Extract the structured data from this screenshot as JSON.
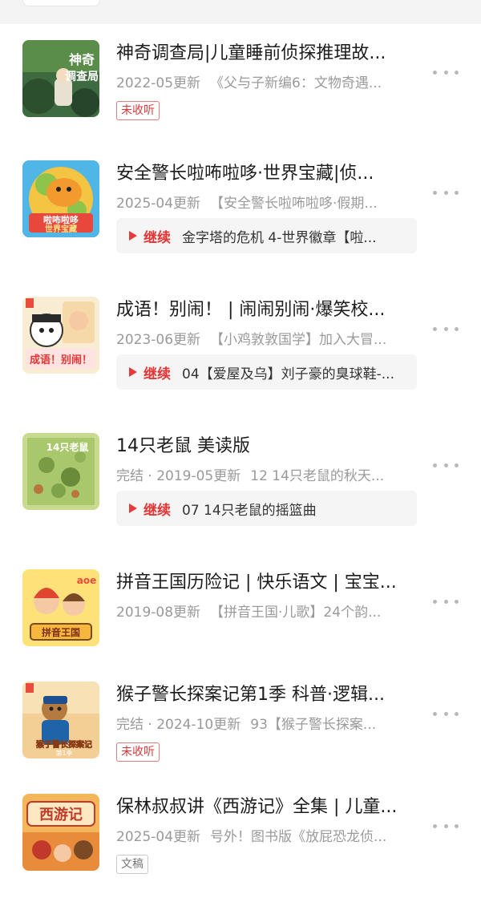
{
  "items": [
    {
      "title": "神奇调查局|儿童睡前侦探推理故...",
      "meta": "2022-05更新",
      "episode": "《父与子新编6：文物奇遇...",
      "badge": "未收听",
      "cover_text": "神奇调查局",
      "cover_colors": [
        "#2f5d3a",
        "#d7e8f4"
      ]
    },
    {
      "title": "安全警长啦咘啦哆·世界宝藏|侦...",
      "meta": "2025-04更新",
      "episode": "【安全警长啦咘啦哆·假期...",
      "continue_label": "继续",
      "continue_episode": "金字塔的危机 4-世界徽章【啦...",
      "cover_text": "啦咘啦哆 世界宝藏",
      "cover_colors": [
        "#3aa6d8",
        "#f3c23a"
      ]
    },
    {
      "title": "成语！别闹！ | 闹闹别闹·爆笑校...",
      "meta": "2023-06更新",
      "episode": "【小鸡敦敦国学】加入大冒...",
      "continue_label": "继续",
      "continue_episode": "04【爱屋及乌】刘子豪的臭球鞋-...",
      "cover_text": "成语！别闹！",
      "cover_colors": [
        "#f7e7c4",
        "#e94b3c"
      ]
    },
    {
      "title": "14只老鼠 美读版",
      "meta": "完结 · 2019-05更新",
      "episode": "12 14只老鼠的秋天...",
      "continue_label": "继续",
      "continue_episode": "07 14只老鼠的摇篮曲",
      "cover_text": "14只老鼠",
      "cover_colors": [
        "#b7cf7a",
        "#6e9a44"
      ]
    },
    {
      "title": "拼音王国历险记 | 快乐语文 | 宝宝...",
      "meta": "2019-08更新",
      "episode": "【拼音王国·儿歌】24个韵...",
      "cover_text": "拼音王国",
      "cover_colors": [
        "#fbd34d",
        "#e0452f"
      ]
    },
    {
      "title": "猴子警长探案记第1季 科普·逻辑...",
      "meta": "完结 · 2024-10更新",
      "episode": "93【猴子警长探案...",
      "badge": "未收听",
      "cover_text": "猴子警长探案记 第1季",
      "cover_colors": [
        "#f6d29a",
        "#1e64a8"
      ]
    },
    {
      "title": "保林叔叔讲《西游记》全集 | 儿童...",
      "meta": "2025-04更新",
      "episode": "号外！图书版《放屁恐龙侦...",
      "badge_gray": "文稿",
      "cover_text": "西游记",
      "cover_colors": [
        "#f0a63a",
        "#c0392b"
      ]
    }
  ]
}
